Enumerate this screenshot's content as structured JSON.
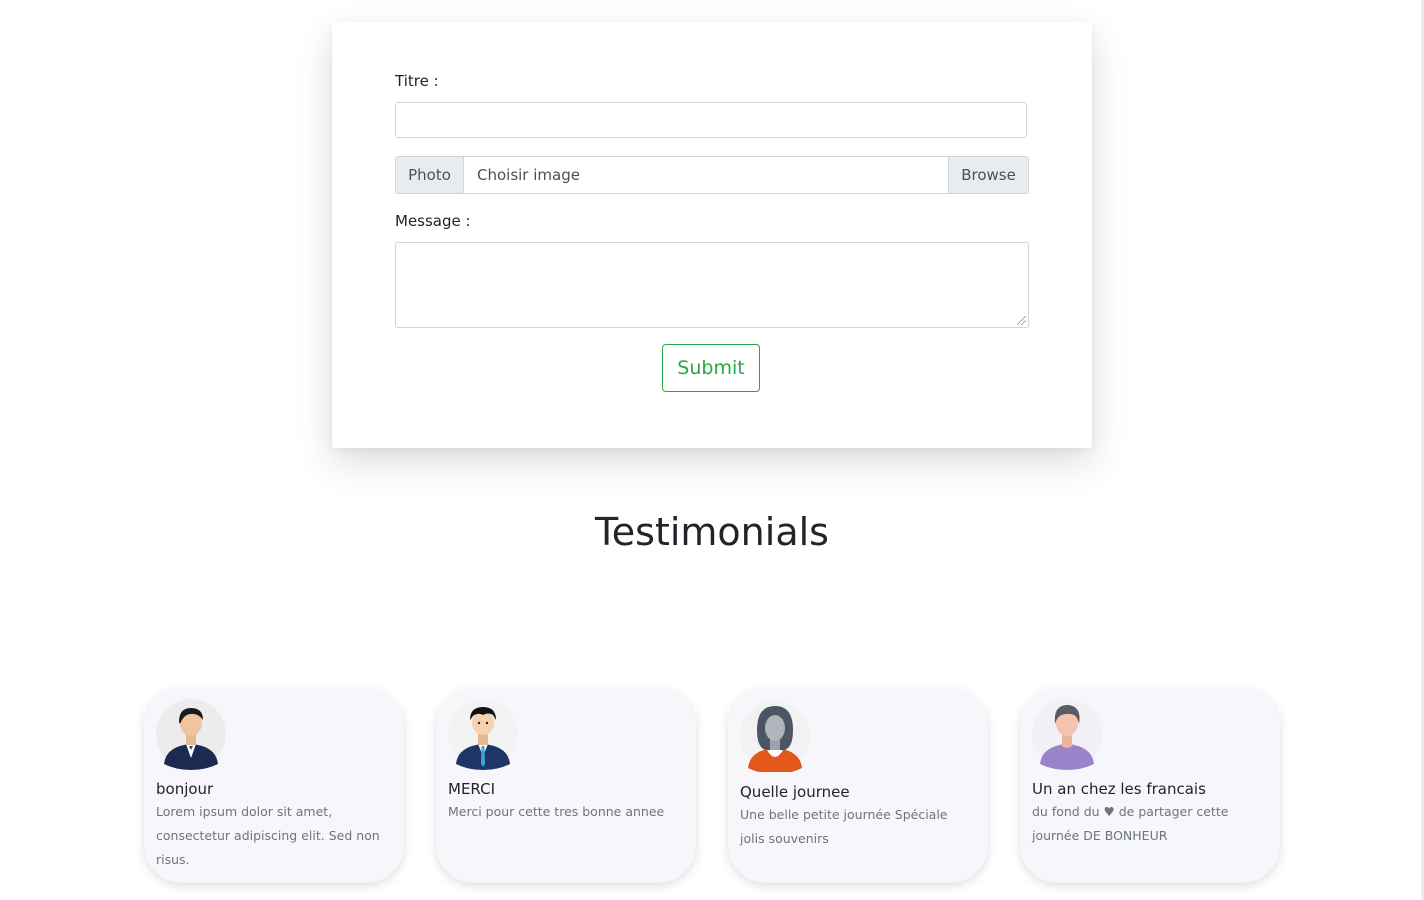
{
  "form": {
    "titre_label": "Titre :",
    "titre_value": "",
    "photo_label": "Photo",
    "photo_placeholder": "Choisir image",
    "browse_label": "Browse",
    "message_label": "Message :",
    "message_value": "",
    "submit_label": "Submit"
  },
  "testimonials": {
    "title": "Testimonials",
    "cards": [
      {
        "name": "bonjour",
        "text": "Lorem ipsum dolor sit amet, consectetur adipiscing elit. Sed non risus.",
        "avatar_icon": "man-suit-avatar-icon"
      },
      {
        "name": "MERCI",
        "text": "Merci pour cette tres bonne annee",
        "avatar_icon": "man-tie-avatar-icon"
      },
      {
        "name": "Quelle journee",
        "text": "Une belle petite journée Spéciale jolis souvenirs",
        "avatar_icon": "woman-avatar-icon"
      },
      {
        "name": "Un an chez les francais",
        "text": "du fond du ♥ de partager cette journée DE BONHEUR",
        "avatar_icon": "man-purple-avatar-icon"
      }
    ]
  },
  "colors": {
    "submit_accent": "#28a745",
    "card_background": "#f7f7fb"
  }
}
